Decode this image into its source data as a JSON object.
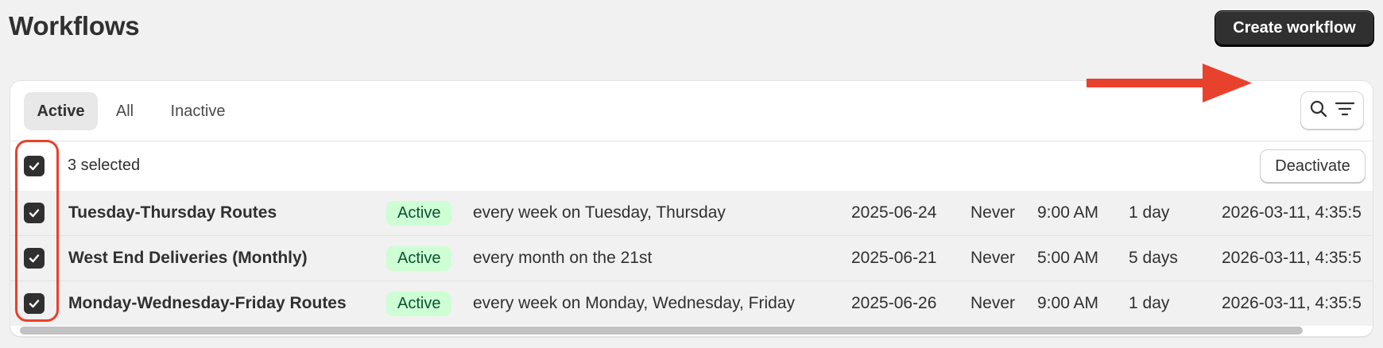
{
  "header": {
    "title": "Workflows",
    "create_button": "Create workflow"
  },
  "tabs": [
    {
      "label": "Active",
      "selected": true
    },
    {
      "label": "All",
      "selected": false
    },
    {
      "label": "Inactive",
      "selected": false
    }
  ],
  "toolbar": {
    "search_filter_icons": [
      "search-icon",
      "filter-icon"
    ]
  },
  "bulk_actions": {
    "selected_text": "3 selected",
    "deactivate_button": "Deactivate"
  },
  "rows": [
    {
      "name": "Tuesday-Thursday Routes",
      "status": "Active",
      "schedule": "every week on Tuesday, Thursday",
      "start_date": "2025-06-24",
      "end": "Never",
      "time": "9:00 AM",
      "duration": "1 day",
      "updated": "2026-03-11, 4:35:5",
      "checked": true
    },
    {
      "name": "West End Deliveries (Monthly)",
      "status": "Active",
      "schedule": "every month on the 21st",
      "start_date": "2025-06-21",
      "end": "Never",
      "time": "5:00 AM",
      "duration": "5 days",
      "updated": "2026-03-11, 4:35:5",
      "checked": true
    },
    {
      "name": "Monday-Wednesday-Friday Routes",
      "status": "Active",
      "schedule": "every week on Monday, Wednesday, Friday",
      "start_date": "2025-06-26",
      "end": "Never",
      "time": "9:00 AM",
      "duration": "1 day",
      "updated": "2026-03-11, 4:35:5",
      "checked": true
    }
  ],
  "colors": {
    "annotation": "#e8412c",
    "badge_bg": "#cdfed4",
    "badge_text": "#0c5132",
    "primary_button": "#303030"
  }
}
